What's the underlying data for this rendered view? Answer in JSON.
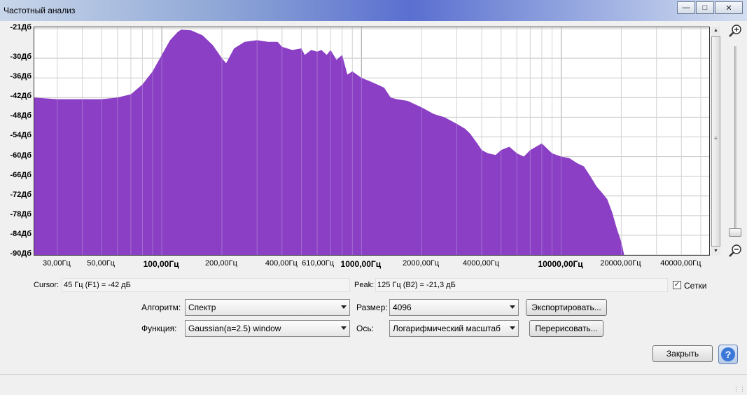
{
  "window": {
    "title": "Частотный анализ"
  },
  "chart_data": {
    "type": "area",
    "xscale": "log",
    "ylim": [
      -90,
      -21
    ],
    "xlim": [
      23,
      56000
    ],
    "color": "#8a3fc4",
    "y_ticks": [
      "-21Дб",
      "-30Дб",
      "-36Дб",
      "-42Дб",
      "-48Дб",
      "-54Дб",
      "-60Дб",
      "-66Дб",
      "-72Дб",
      "-78Дб",
      "-84Дб",
      "-90Дб"
    ],
    "y_tick_values": [
      -21,
      -30,
      -36,
      -42,
      -48,
      -54,
      -60,
      -66,
      -72,
      -78,
      -84,
      -90
    ],
    "x_ticks": [
      {
        "label": "30,00Гц",
        "value": 30,
        "bold": false
      },
      {
        "label": "50,00Гц",
        "value": 50,
        "bold": false
      },
      {
        "label": "100,00Гц",
        "value": 100,
        "bold": true
      },
      {
        "label": "200,00Гц",
        "value": 200,
        "bold": false
      },
      {
        "label": "400,00Гц",
        "value": 400,
        "bold": false
      },
      {
        "label": "610,00Гц",
        "value": 610,
        "bold": false
      },
      {
        "label": "1000,00Гц",
        "value": 1000,
        "bold": true
      },
      {
        "label": "2000,00Гц",
        "value": 2000,
        "bold": false
      },
      {
        "label": "4000,00Гц",
        "value": 4000,
        "bold": false
      },
      {
        "label": "10000,00Гц",
        "value": 10000,
        "bold": true
      },
      {
        "label": "20000,00Гц",
        "value": 20000,
        "bold": false
      },
      {
        "label": "40000,00Гц",
        "value": 40000,
        "bold": false
      }
    ],
    "spectrum": {
      "x": [
        23,
        30,
        40,
        50,
        60,
        70,
        80,
        90,
        100,
        110,
        120,
        125,
        140,
        160,
        180,
        200,
        210,
        230,
        260,
        300,
        340,
        380,
        400,
        450,
        500,
        520,
        560,
        600,
        630,
        670,
        700,
        750,
        800,
        850,
        900,
        1000,
        1100,
        1200,
        1300,
        1400,
        1500,
        1700,
        2000,
        2300,
        2600,
        3000,
        3300,
        3500,
        3800,
        4000,
        4300,
        4700,
        5000,
        5500,
        6000,
        6500,
        7000,
        8000,
        9000,
        10000,
        11000,
        12000,
        13000,
        14000,
        15000,
        16000,
        17000,
        18000,
        19000,
        20000,
        20500,
        21000
      ],
      "y": [
        -42,
        -42.5,
        -42.5,
        -42.5,
        -42,
        -41,
        -38,
        -34,
        -29,
        -24.5,
        -22,
        -21.3,
        -21.5,
        -23,
        -26,
        -30,
        -31.5,
        -27,
        -25,
        -24.5,
        -25,
        -25,
        -26.5,
        -27.5,
        -27,
        -29,
        -27.5,
        -28,
        -27.5,
        -29,
        -27.5,
        -30.5,
        -29,
        -35,
        -34,
        -36,
        -37,
        -38,
        -39,
        -42,
        -42.5,
        -43,
        -45,
        -47,
        -48,
        -50,
        -51.5,
        -53,
        -56,
        -58,
        -59,
        -59.5,
        -58,
        -57,
        -59,
        -60,
        -58,
        -56,
        -59,
        -60,
        -60.5,
        -62,
        -63,
        -66,
        -69,
        -71,
        -73,
        -77,
        -82,
        -86,
        -89,
        -92
      ]
    }
  },
  "info": {
    "cursor_label": "Cursor:",
    "cursor_value": "45 Гц (F1) = -42 дБ",
    "peak_label": "Peak:",
    "peak_value": "125 Гц (B2) = -21,3 дБ",
    "grid_label": "Сетки",
    "grid_checked": true
  },
  "controls": {
    "algorithm_label": "Алгоритм:",
    "algorithm_value": "Спектр",
    "function_label": "Функция:",
    "function_value": "Gaussian(a=2.5) window",
    "size_label": "Размер:",
    "size_value": "4096",
    "axis_label": "Ось:",
    "axis_value": "Логарифмический масштаб",
    "export_button": "Экспортировать...",
    "replot_button": "Перерисовать...",
    "close_button": "Закрыть",
    "help_glyph": "?"
  }
}
